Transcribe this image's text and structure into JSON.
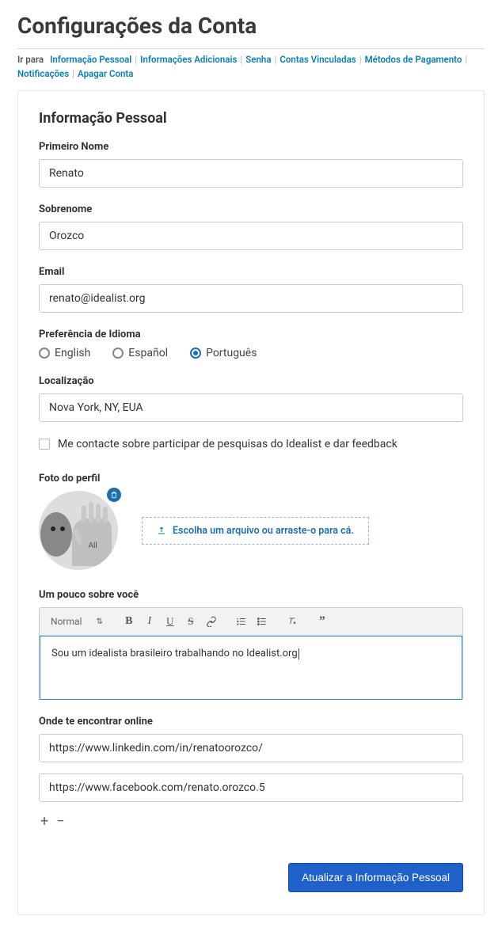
{
  "page_title": "Configurações da Conta",
  "skipnav": {
    "lead": "Ir para",
    "links": [
      "Informação Pessoal",
      "Informações Adicionais",
      "Senha",
      "Contas Vinculadas",
      "Métodos de Pagamento",
      "Notificações",
      "Apagar Conta"
    ]
  },
  "section_title": "Informação Pessoal",
  "fields": {
    "first_name_label": "Primeiro Nome",
    "first_name_value": "Renato",
    "last_name_label": "Sobrenome",
    "last_name_value": "Orozco",
    "email_label": "Email",
    "email_value": "renato@idealist.org",
    "language_label": "Preferência de Idioma",
    "language_options": {
      "en": "English",
      "es": "Español",
      "pt": "Português"
    },
    "language_selected": "pt",
    "location_label": "Localização",
    "location_value": "Nova York, NY, EUA",
    "contact_checkbox_label": "Me contacte sobre participar de pesquisas do Idealist e dar feedback",
    "profile_photo_label": "Foto do perfil",
    "upload_text": "Escolha um arquivo ou arraste-o para cá.",
    "about_label": "Um pouco sobre você",
    "editor_format": "Normal",
    "about_value": "Sou um idealista brasileiro trabalhando no Idealist.org",
    "online_label": "Onde te encontrar online",
    "online_link1": "https://www.linkedin.com/in/renatoorozco/",
    "online_link2": "https://www.facebook.com/renato.orozco.5",
    "submit_label": "Atualizar a Informação Pessoal"
  }
}
